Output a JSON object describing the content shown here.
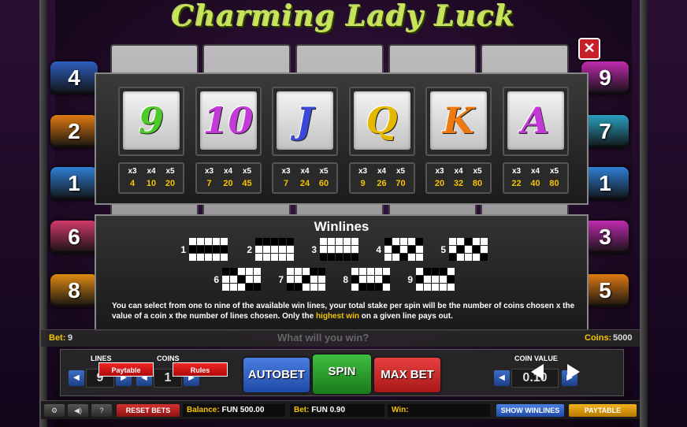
{
  "game": {
    "title": "Charming Lady Luck"
  },
  "left_line_badges": [
    "4",
    "2",
    "1",
    "6",
    "8"
  ],
  "right_line_badges": [
    "9",
    "7",
    "1",
    "3",
    "5"
  ],
  "close_label": "✕",
  "paytable": [
    {
      "symbol": "9",
      "color": "#4ecb2a",
      "x3": "x3",
      "x4": "x4",
      "x5": "x5",
      "v3": "4",
      "v4": "10",
      "v5": "20"
    },
    {
      "symbol": "10",
      "color": "#c23bd6",
      "x3": "x3",
      "x4": "x4",
      "x5": "x5",
      "v3": "7",
      "v4": "20",
      "v5": "45"
    },
    {
      "symbol": "J",
      "color": "#3a4ad8",
      "x3": "x3",
      "x4": "x4",
      "x5": "x5",
      "v3": "7",
      "v4": "24",
      "v5": "60"
    },
    {
      "symbol": "Q",
      "color": "#e5b800",
      "x3": "x3",
      "x4": "x4",
      "x5": "x5",
      "v3": "9",
      "v4": "26",
      "v5": "70"
    },
    {
      "symbol": "K",
      "color": "#f07a10",
      "x3": "x3",
      "x4": "x4",
      "x5": "x5",
      "v3": "20",
      "v4": "32",
      "v5": "80"
    },
    {
      "symbol": "A",
      "color": "#c23bd6",
      "x3": "x3",
      "x4": "x4",
      "x5": "x5",
      "v3": "22",
      "v4": "40",
      "v5": "80"
    }
  ],
  "winlines": {
    "title": "Winlines",
    "lines": [
      {
        "num": "1",
        "rows": [
          1,
          1,
          1,
          1,
          1
        ]
      },
      {
        "num": "2",
        "rows": [
          0,
          0,
          0,
          0,
          0
        ]
      },
      {
        "num": "3",
        "rows": [
          2,
          2,
          2,
          2,
          2
        ]
      },
      {
        "num": "4",
        "rows": [
          0,
          1,
          2,
          1,
          0
        ]
      },
      {
        "num": "5",
        "rows": [
          2,
          1,
          0,
          1,
          2
        ]
      },
      {
        "num": "6",
        "rows": [
          0,
          0,
          1,
          2,
          2
        ]
      },
      {
        "num": "7",
        "rows": [
          2,
          2,
          1,
          0,
          0
        ]
      },
      {
        "num": "8",
        "rows": [
          1,
          2,
          2,
          2,
          1
        ]
      },
      {
        "num": "9",
        "rows": [
          1,
          0,
          0,
          0,
          1
        ]
      }
    ],
    "text_part1": "You can select from one to nine of the available win lines, your total stake per spin will be the number of coins chosen x the value of a coin x the number of lines chosen. Only the ",
    "text_highlight": "highest win",
    "text_part2": " on a given line pays out."
  },
  "status": {
    "bet_label": "Bet:",
    "bet_value": "9",
    "message": "What will you win?",
    "coins_label": "Coins:",
    "coins_value": "5000"
  },
  "controls": {
    "lines_label": "LINES",
    "lines_value": "9",
    "coins_label": "COINS",
    "coins_value": "1",
    "paytable_tab": "Paytable",
    "rules_tab": "Rules",
    "autobet": "AUTOBET",
    "spin": "SPIN",
    "max_bet": "MAX BET",
    "coin_value_label": "COIN VALUE",
    "coin_value": "0.10"
  },
  "bottom": {
    "reset_bets": "RESET BETS",
    "balance_label": "Balance:",
    "balance_value": "FUN 500.00",
    "bet_label": "Bet:",
    "bet_value": "FUN 0.90",
    "win_label": "Win:",
    "show_winlines": "SHOW WINLINES",
    "paytable": "PAYTABLE",
    "settings_icon": "⚙",
    "sound_icon": "◀)",
    "help_icon": "?"
  },
  "colors": {
    "accent_yellow": "#f5c400",
    "title_green": "#c8e45a"
  }
}
